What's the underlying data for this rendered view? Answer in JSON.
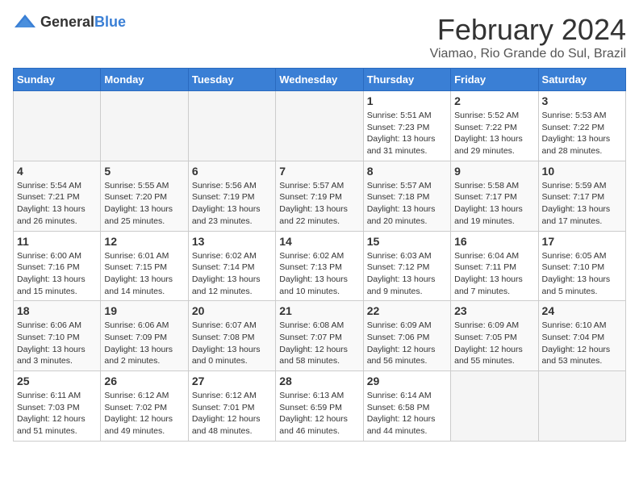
{
  "logo": {
    "general": "General",
    "blue": "Blue"
  },
  "title": "February 2024",
  "subtitle": "Viamao, Rio Grande do Sul, Brazil",
  "days_of_week": [
    "Sunday",
    "Monday",
    "Tuesday",
    "Wednesday",
    "Thursday",
    "Friday",
    "Saturday"
  ],
  "weeks": [
    [
      {
        "day": "",
        "info": ""
      },
      {
        "day": "",
        "info": ""
      },
      {
        "day": "",
        "info": ""
      },
      {
        "day": "",
        "info": ""
      },
      {
        "day": "1",
        "info": "Sunrise: 5:51 AM\nSunset: 7:23 PM\nDaylight: 13 hours\nand 31 minutes."
      },
      {
        "day": "2",
        "info": "Sunrise: 5:52 AM\nSunset: 7:22 PM\nDaylight: 13 hours\nand 29 minutes."
      },
      {
        "day": "3",
        "info": "Sunrise: 5:53 AM\nSunset: 7:22 PM\nDaylight: 13 hours\nand 28 minutes."
      }
    ],
    [
      {
        "day": "4",
        "info": "Sunrise: 5:54 AM\nSunset: 7:21 PM\nDaylight: 13 hours\nand 26 minutes."
      },
      {
        "day": "5",
        "info": "Sunrise: 5:55 AM\nSunset: 7:20 PM\nDaylight: 13 hours\nand 25 minutes."
      },
      {
        "day": "6",
        "info": "Sunrise: 5:56 AM\nSunset: 7:19 PM\nDaylight: 13 hours\nand 23 minutes."
      },
      {
        "day": "7",
        "info": "Sunrise: 5:57 AM\nSunset: 7:19 PM\nDaylight: 13 hours\nand 22 minutes."
      },
      {
        "day": "8",
        "info": "Sunrise: 5:57 AM\nSunset: 7:18 PM\nDaylight: 13 hours\nand 20 minutes."
      },
      {
        "day": "9",
        "info": "Sunrise: 5:58 AM\nSunset: 7:17 PM\nDaylight: 13 hours\nand 19 minutes."
      },
      {
        "day": "10",
        "info": "Sunrise: 5:59 AM\nSunset: 7:17 PM\nDaylight: 13 hours\nand 17 minutes."
      }
    ],
    [
      {
        "day": "11",
        "info": "Sunrise: 6:00 AM\nSunset: 7:16 PM\nDaylight: 13 hours\nand 15 minutes."
      },
      {
        "day": "12",
        "info": "Sunrise: 6:01 AM\nSunset: 7:15 PM\nDaylight: 13 hours\nand 14 minutes."
      },
      {
        "day": "13",
        "info": "Sunrise: 6:02 AM\nSunset: 7:14 PM\nDaylight: 13 hours\nand 12 minutes."
      },
      {
        "day": "14",
        "info": "Sunrise: 6:02 AM\nSunset: 7:13 PM\nDaylight: 13 hours\nand 10 minutes."
      },
      {
        "day": "15",
        "info": "Sunrise: 6:03 AM\nSunset: 7:12 PM\nDaylight: 13 hours\nand 9 minutes."
      },
      {
        "day": "16",
        "info": "Sunrise: 6:04 AM\nSunset: 7:11 PM\nDaylight: 13 hours\nand 7 minutes."
      },
      {
        "day": "17",
        "info": "Sunrise: 6:05 AM\nSunset: 7:10 PM\nDaylight: 13 hours\nand 5 minutes."
      }
    ],
    [
      {
        "day": "18",
        "info": "Sunrise: 6:06 AM\nSunset: 7:10 PM\nDaylight: 13 hours\nand 3 minutes."
      },
      {
        "day": "19",
        "info": "Sunrise: 6:06 AM\nSunset: 7:09 PM\nDaylight: 13 hours\nand 2 minutes."
      },
      {
        "day": "20",
        "info": "Sunrise: 6:07 AM\nSunset: 7:08 PM\nDaylight: 13 hours\nand 0 minutes."
      },
      {
        "day": "21",
        "info": "Sunrise: 6:08 AM\nSunset: 7:07 PM\nDaylight: 12 hours\nand 58 minutes."
      },
      {
        "day": "22",
        "info": "Sunrise: 6:09 AM\nSunset: 7:06 PM\nDaylight: 12 hours\nand 56 minutes."
      },
      {
        "day": "23",
        "info": "Sunrise: 6:09 AM\nSunset: 7:05 PM\nDaylight: 12 hours\nand 55 minutes."
      },
      {
        "day": "24",
        "info": "Sunrise: 6:10 AM\nSunset: 7:04 PM\nDaylight: 12 hours\nand 53 minutes."
      }
    ],
    [
      {
        "day": "25",
        "info": "Sunrise: 6:11 AM\nSunset: 7:03 PM\nDaylight: 12 hours\nand 51 minutes."
      },
      {
        "day": "26",
        "info": "Sunrise: 6:12 AM\nSunset: 7:02 PM\nDaylight: 12 hours\nand 49 minutes."
      },
      {
        "day": "27",
        "info": "Sunrise: 6:12 AM\nSunset: 7:01 PM\nDaylight: 12 hours\nand 48 minutes."
      },
      {
        "day": "28",
        "info": "Sunrise: 6:13 AM\nSunset: 6:59 PM\nDaylight: 12 hours\nand 46 minutes."
      },
      {
        "day": "29",
        "info": "Sunrise: 6:14 AM\nSunset: 6:58 PM\nDaylight: 12 hours\nand 44 minutes."
      },
      {
        "day": "",
        "info": ""
      },
      {
        "day": "",
        "info": ""
      }
    ]
  ]
}
